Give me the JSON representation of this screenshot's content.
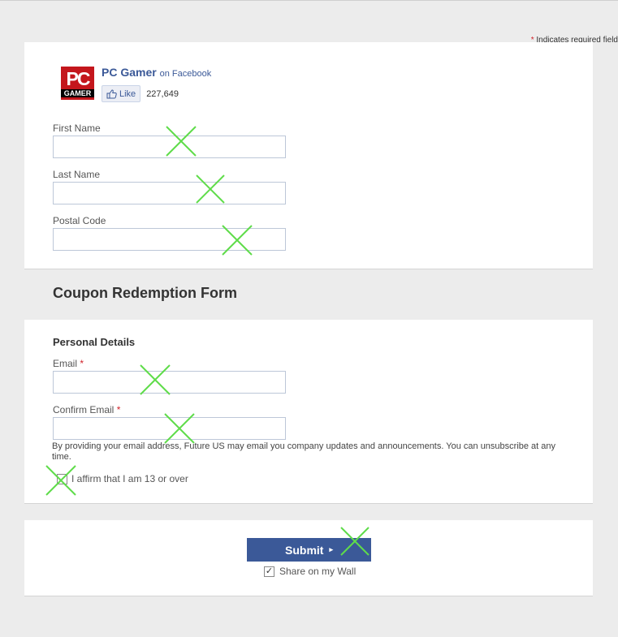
{
  "header": {
    "required_note": "Indicates required field",
    "required_star": "*"
  },
  "page": {
    "logo_top": "PC",
    "logo_bottom": "GAMER",
    "name": "PC Gamer",
    "on_text": "on Facebook",
    "like_label": "Like",
    "like_count": "227,649"
  },
  "fields_top": [
    {
      "label": "First Name",
      "value": ""
    },
    {
      "label": "Last Name",
      "value": ""
    },
    {
      "label": "Postal Code",
      "value": ""
    }
  ],
  "form_title": "Coupon Redemption Form",
  "personal": {
    "section_title": "Personal Details",
    "email_label": "Email",
    "email_value": "",
    "confirm_label": "Confirm Email",
    "confirm_value": "",
    "required_star": "*",
    "disclaimer": "By providing your email address, Future US may email you company updates and announcements. You can unsubscribe at any time.",
    "affirm_label": "I affirm that I am 13 or over",
    "affirm_checked": false
  },
  "submit": {
    "label": "Submit",
    "arrow": "▸",
    "share_label": "Share on my Wall",
    "share_checked": true,
    "share_check_glyph": "✓"
  },
  "annotation": {
    "mark_color": "#5fdc4a",
    "mark_glyph": "cross-mark"
  }
}
